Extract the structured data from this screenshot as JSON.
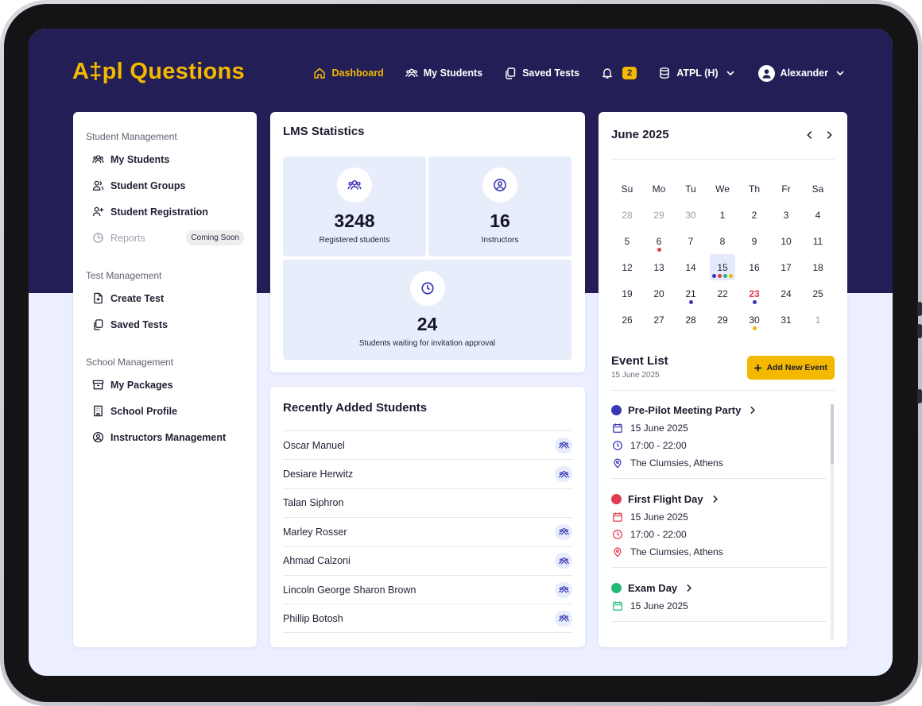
{
  "app": {
    "logo": "A‡pl Questions"
  },
  "nav": {
    "dashboard": "Dashboard",
    "my_students": "My Students",
    "saved_tests": "Saved Tests",
    "notifications": "2",
    "license": "ATPL (H)",
    "user": "Alexander"
  },
  "sidebar": {
    "student_mgmt": "Student Management",
    "my_students": "My Students",
    "student_groups": "Student Groups",
    "student_registration": "Student Registration",
    "reports": "Reports",
    "coming_soon": "Coming Soon",
    "test_mgmt": "Test Management",
    "create_test": "Create Test",
    "saved_tests": "Saved Tests",
    "school_mgmt": "School Management",
    "my_packages": "My Packages",
    "school_profile": "School Profile",
    "instructors_mgmt": "Instructors Management"
  },
  "lms": {
    "title": "LMS Statistics",
    "registered_value": "3248",
    "registered_label": "Registered students",
    "instructors_value": "16",
    "instructors_label": "Instructors",
    "waiting_value": "24",
    "waiting_label": "Students waiting for invitation approval"
  },
  "recent": {
    "title": "Recently Added Students",
    "rows": [
      {
        "name": "Oscar Manuel",
        "icon": "users-icon"
      },
      {
        "name": "Desiare Herwitz",
        "icon": "users-icon"
      },
      {
        "name": "Talan Siphron",
        "icon": ""
      },
      {
        "name": "Marley Rosser",
        "icon": "users-icon"
      },
      {
        "name": "Ahmad Calzoni",
        "icon": "users-icon"
      },
      {
        "name": "Lincoln George Sharon Brown",
        "icon": "users-icon"
      },
      {
        "name": "Phillip Botosh",
        "icon": "users-icon"
      }
    ]
  },
  "calendar": {
    "month": "June 2025",
    "dow": [
      "Su",
      "Mo",
      "Tu",
      "We",
      "Th",
      "Fr",
      "Sa"
    ],
    "days": [
      {
        "n": "28",
        "muted": true
      },
      {
        "n": "29",
        "muted": true
      },
      {
        "n": "30",
        "muted": true
      },
      {
        "n": "1"
      },
      {
        "n": "2"
      },
      {
        "n": "3"
      },
      {
        "n": "4"
      },
      {
        "n": "5"
      },
      {
        "n": "6",
        "dots": [
          "#e23a4e"
        ]
      },
      {
        "n": "7"
      },
      {
        "n": "8"
      },
      {
        "n": "9"
      },
      {
        "n": "10"
      },
      {
        "n": "11"
      },
      {
        "n": "12"
      },
      {
        "n": "13"
      },
      {
        "n": "14"
      },
      {
        "n": "15",
        "today": true,
        "dots": [
          "#3b35b8",
          "#e23a4e",
          "#1fba7a",
          "#f5b800"
        ]
      },
      {
        "n": "16"
      },
      {
        "n": "17"
      },
      {
        "n": "18"
      },
      {
        "n": "19"
      },
      {
        "n": "20"
      },
      {
        "n": "21",
        "dots": [
          "#3b35b8"
        ]
      },
      {
        "n": "22"
      },
      {
        "n": "23",
        "red": true,
        "dots": [
          "#3b35b8"
        ]
      },
      {
        "n": "24"
      },
      {
        "n": "25"
      },
      {
        "n": "26"
      },
      {
        "n": "27"
      },
      {
        "n": "28"
      },
      {
        "n": "29"
      },
      {
        "n": "30",
        "dots": [
          "#f5b800"
        ]
      },
      {
        "n": "31"
      },
      {
        "n": "1",
        "muted": true
      }
    ]
  },
  "events": {
    "title": "Event List",
    "date": "15 June 2025",
    "add_label": "Add New Event",
    "items": [
      {
        "title": "Pre-Pilot Meeting Party",
        "color": "#3b35b8",
        "date": "15 June 2025",
        "time": "17:00 - 22:00",
        "place": "The Clumsies, Athens"
      },
      {
        "title": "First Flight Day",
        "color": "#e23a4e",
        "date": "15 June 2025",
        "time": "17:00 - 22:00",
        "place": "The Clumsies, Athens"
      },
      {
        "title": "Exam Day",
        "color": "#1fba7a",
        "date": "15 June 2025",
        "time": "",
        "place": ""
      }
    ]
  },
  "colors": {
    "primary": "#231f56",
    "accent": "#f5b800",
    "background": "#ecefff",
    "icon": "#3b35b8"
  }
}
